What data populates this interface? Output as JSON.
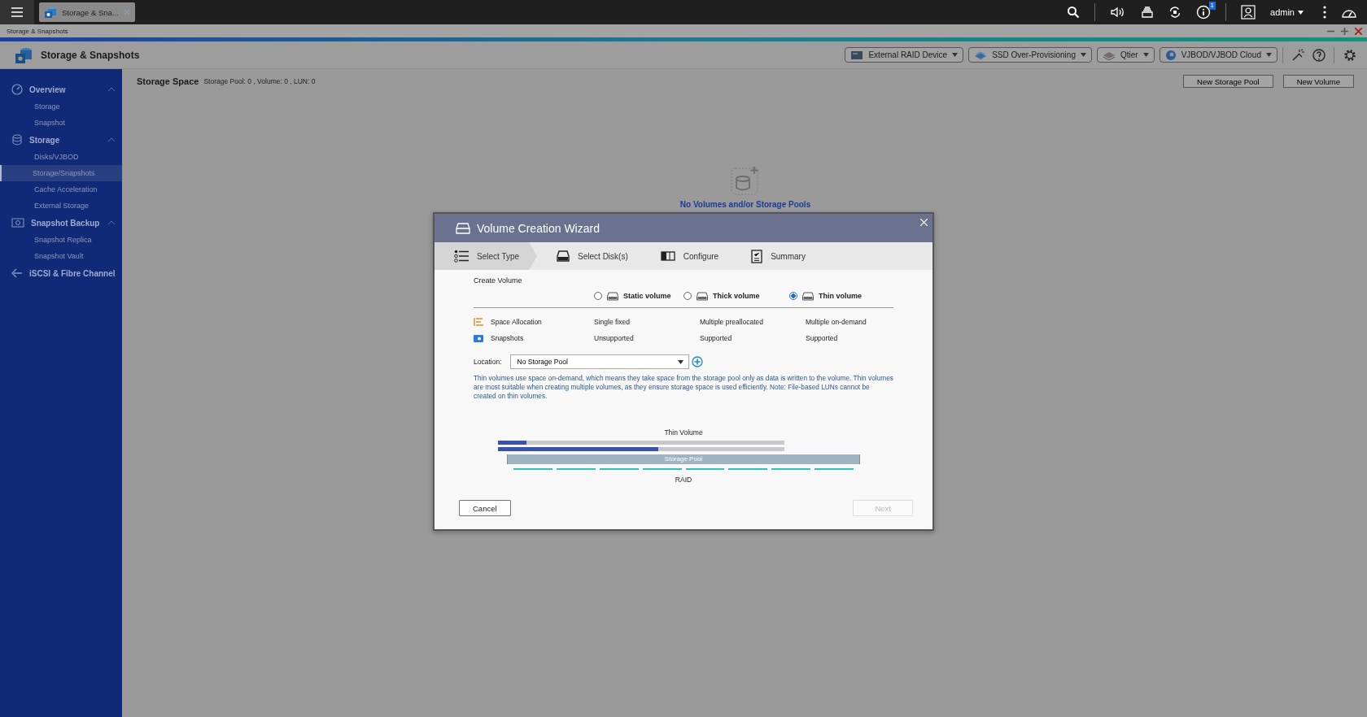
{
  "taskbar": {
    "tabs": [
      {
        "label": "Storage & Sna...",
        "selected": true
      }
    ],
    "notification_count": "1",
    "user": "admin"
  },
  "window": {
    "title": "Storage & Snapshots"
  },
  "app_header": {
    "title": "Storage & Snapshots",
    "toolbar": [
      {
        "label": "External RAID Device",
        "kind": "raid"
      },
      {
        "label": "SSD Over-Provisioning",
        "kind": "ssd"
      },
      {
        "label": "Qtier",
        "kind": "qtier"
      },
      {
        "label": "VJBOD/VJBOD Cloud",
        "kind": "cloud"
      }
    ]
  },
  "sidebar": {
    "sections": [
      {
        "label": "Overview",
        "kind": "gauge",
        "expanded": true,
        "children": [
          {
            "label": "Storage",
            "selected": false
          },
          {
            "label": "Snapshot",
            "selected": false
          }
        ]
      },
      {
        "label": "Storage",
        "kind": "database",
        "expanded": true,
        "children": [
          {
            "label": "Disks/VJBOD",
            "selected": false
          },
          {
            "label": "Storage/Snapshots",
            "selected": true
          },
          {
            "label": "Cache Acceleration",
            "selected": false
          },
          {
            "label": "External Storage",
            "selected": false
          }
        ]
      },
      {
        "label": "Snapshot Backup",
        "kind": "camera",
        "expanded": true,
        "children": [
          {
            "label": "Snapshot Replica",
            "selected": false
          },
          {
            "label": "Snapshot Vault",
            "selected": false
          }
        ]
      },
      {
        "label": "iSCSI & Fibre Channel",
        "kind": "plug"
      }
    ]
  },
  "content": {
    "heading": "Storage Space",
    "summary": "Storage Pool: 0 , Volume: 0 , LUN: 0",
    "actions": [
      "New Storage Pool",
      "New Volume"
    ],
    "empty_message": "No Volumes and/or Storage Pools"
  },
  "wizard": {
    "title": "Volume Creation Wizard",
    "steps": [
      {
        "label": "Select Type",
        "kind": "list",
        "selected": true
      },
      {
        "label": "Select Disk(s)",
        "kind": "disk",
        "selected": false
      },
      {
        "label": "Configure",
        "kind": "config",
        "selected": false
      },
      {
        "label": "Summary",
        "kind": "clipboard",
        "selected": false
      }
    ],
    "section_title": "Create Volume",
    "options": [
      {
        "label": "Static volume",
        "selected": false
      },
      {
        "label": "Thick volume",
        "selected": false
      },
      {
        "label": "Thin volume",
        "selected": true
      }
    ],
    "features": [
      {
        "label": "Space Allocation",
        "kind": "allocation",
        "values": [
          "Single fixed",
          "Multiple preallocated",
          "Multiple on-demand"
        ]
      },
      {
        "label": "Snapshots",
        "kind": "snapshot",
        "values": [
          "Unsupported",
          "Supported",
          "Supported"
        ]
      }
    ],
    "location": {
      "label": "Location:",
      "value": "No Storage Pool"
    },
    "note": "Thin volumes use space on-demand, which means they take space from the storage pool only as data is written to the volume. Thin volumes are most suitable when creating multiple volumes, as they ensure storage space is used efficiently. Note: File-based LUNs cannot be created on thin volumes.",
    "diagram": {
      "title": "Thin Volume",
      "volumes": [
        {
          "level": 0.1
        },
        {
          "level": 0.56
        }
      ],
      "pool_label": "Storage Pool",
      "raid_label": "RAID"
    },
    "buttons": [
      {
        "label": "Cancel",
        "disabled": false
      },
      {
        "label": "Next",
        "disabled": true
      }
    ]
  }
}
